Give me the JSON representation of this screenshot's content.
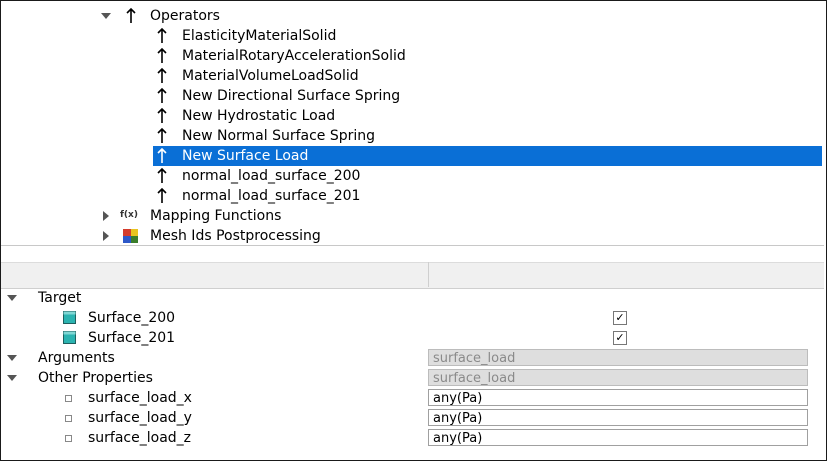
{
  "tree": {
    "operators_label": "Operators",
    "operators": [
      "ElasticityMaterialSolid",
      "MaterialRotaryAccelerationSolid",
      "MaterialVolumeLoadSolid",
      "New Directional Surface Spring",
      "New Hydrostatic Load",
      "New Normal Surface Spring",
      "New Surface Load",
      "normal_load_surface_200",
      "normal_load_surface_201"
    ],
    "selected_operator": "New Surface Load",
    "mapping_label": "Mapping Functions",
    "mapping_icon_glyph": "f(x)",
    "mesh_label": "Mesh Ids Postprocessing"
  },
  "props": {
    "target_label": "Target",
    "targets": [
      {
        "label": "Surface_200",
        "checked": "✓"
      },
      {
        "label": "Surface_201",
        "checked": "✓"
      }
    ],
    "arguments_label": "Arguments",
    "arguments_value": "surface_load",
    "other_label": "Other Properties",
    "other_value": "surface_load",
    "fields": [
      {
        "label": "surface_load_x",
        "value": "any(Pa)"
      },
      {
        "label": "surface_load_y",
        "value": "any(Pa)"
      },
      {
        "label": "surface_load_z",
        "value": "any(Pa)"
      }
    ]
  },
  "colors": {
    "selection": "#0a6fd6",
    "cube": "#2bb3b0"
  }
}
